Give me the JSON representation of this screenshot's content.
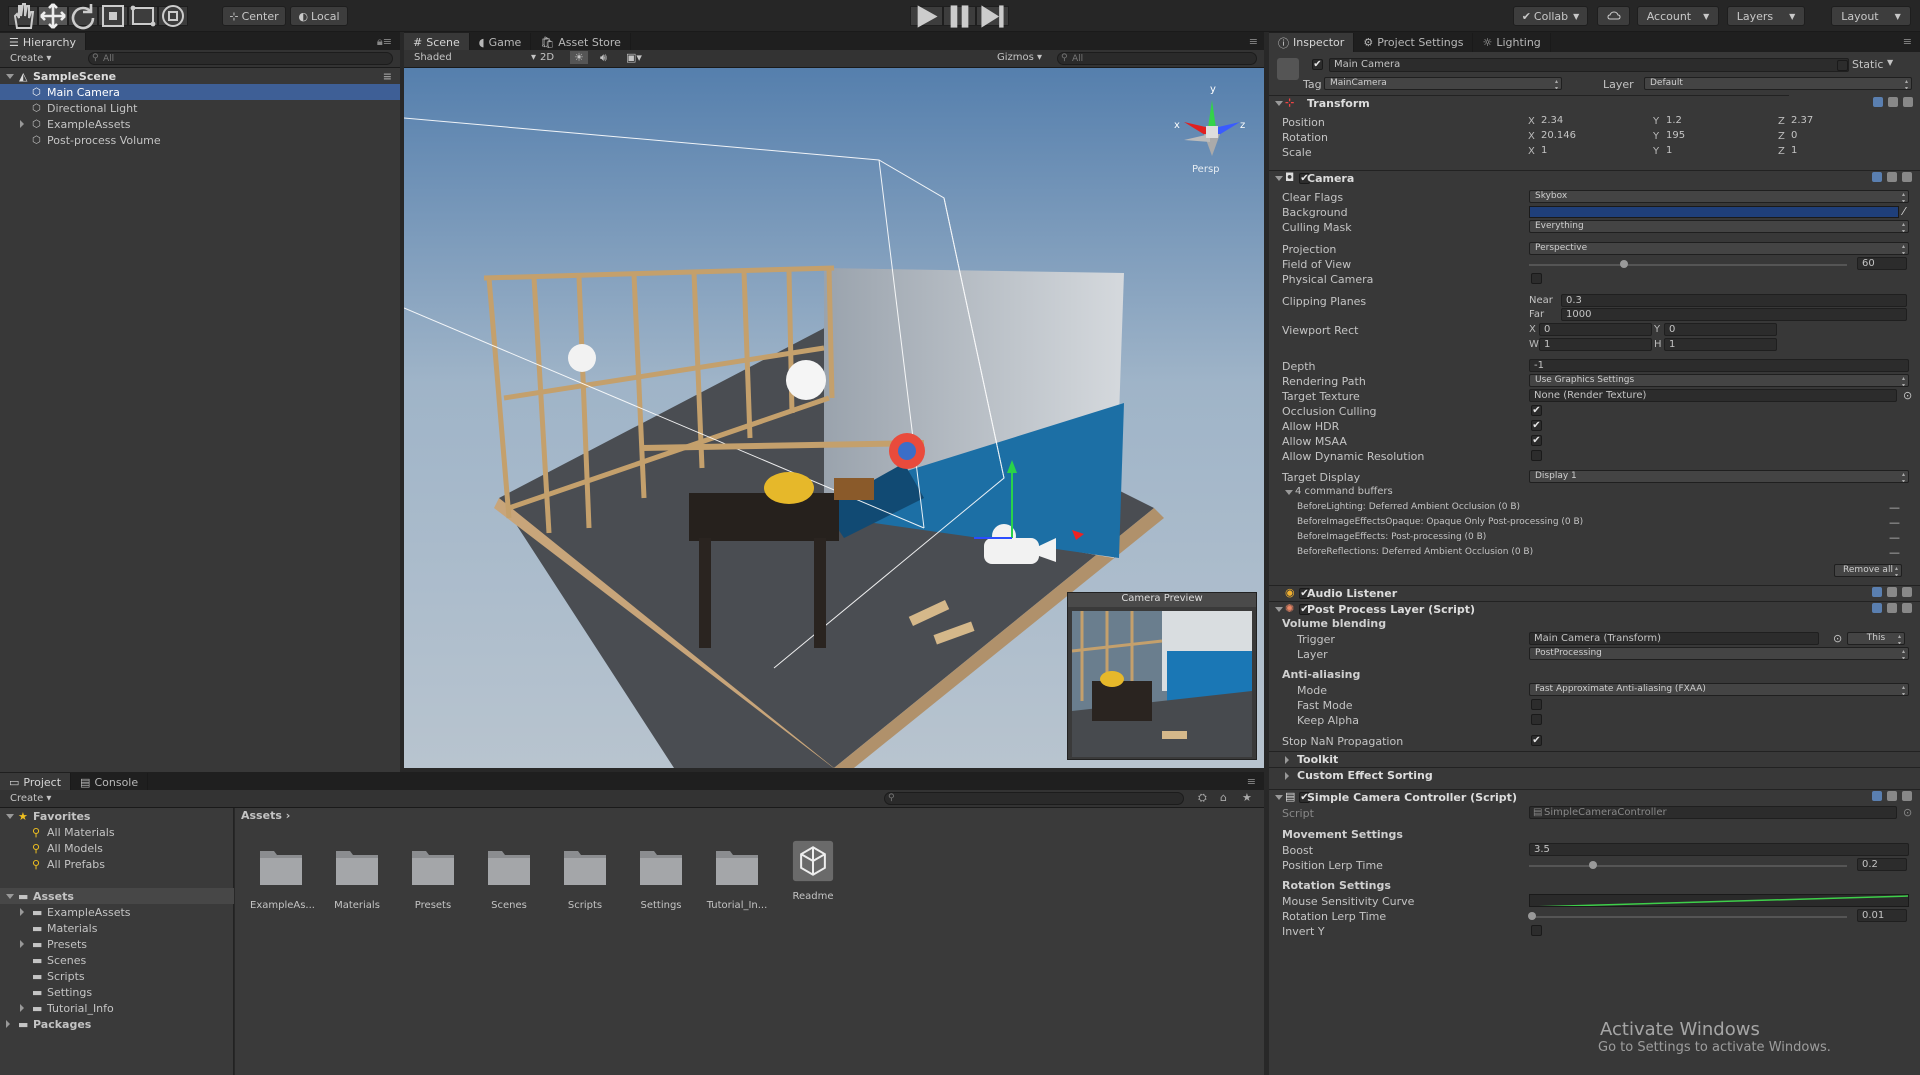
{
  "toolbar": {
    "pivot": "Center",
    "space": "Local",
    "collab": "Collab",
    "account": "Account",
    "layers": "Layers",
    "layout": "Layout",
    "tools": [
      "hand-tool",
      "move-tool",
      "rotate-tool",
      "scale-tool",
      "rect-tool",
      "transform-tool"
    ]
  },
  "hierarchy": {
    "tab": "Hierarchy",
    "create": "Create",
    "search": "All",
    "scene": "SampleScene",
    "items": [
      "Main Camera",
      "Directional Light",
      "ExampleAssets",
      "Post-process Volume"
    ]
  },
  "scene_view": {
    "tabs": [
      "Scene",
      "Game",
      "Asset Store"
    ],
    "shading": "Shaded",
    "mode_2d": "2D",
    "gizmos": "Gizmos",
    "search": "All",
    "persp": "Persp",
    "camera_preview": "Camera Preview",
    "axes": {
      "x": "x",
      "y": "y",
      "z": "z"
    }
  },
  "project": {
    "tabs": [
      "Project",
      "Console"
    ],
    "create": "Create",
    "favorites_label": "Favorites",
    "favorites": [
      "All Materials",
      "All Models",
      "All Prefabs"
    ],
    "assets_label": "Assets",
    "assets_tree": [
      "ExampleAssets",
      "Materials",
      "Presets",
      "Scenes",
      "Scripts",
      "Settings",
      "Tutorial_Info"
    ],
    "packages_label": "Packages",
    "breadcrumb": "Assets",
    "grid": [
      "ExampleAs...",
      "Materials",
      "Presets",
      "Scenes",
      "Scripts",
      "Settings",
      "Tutorial_In...",
      "Readme"
    ]
  },
  "inspector": {
    "tabs": [
      "Inspector",
      "Project Settings",
      "Lighting"
    ],
    "object_name": "Main Camera",
    "static_label": "Static",
    "tag_label": "Tag",
    "tag_value": "MainCamera",
    "layer_label": "Layer",
    "layer_value": "Default",
    "transform": {
      "title": "Transform",
      "position": {
        "label": "Position",
        "x": "2.34",
        "y": "1.2",
        "z": "2.37"
      },
      "rotation": {
        "label": "Rotation",
        "x": "20.146",
        "y": "195",
        "z": "0"
      },
      "scale": {
        "label": "Scale",
        "x": "1",
        "y": "1",
        "z": "1"
      }
    },
    "camera": {
      "title": "Camera",
      "clear_flags": {
        "label": "Clear Flags",
        "value": "Skybox"
      },
      "background": {
        "label": "Background",
        "color": "#1f3f7a"
      },
      "culling_mask": {
        "label": "Culling Mask",
        "value": "Everything"
      },
      "projection": {
        "label": "Projection",
        "value": "Perspective"
      },
      "fov": {
        "label": "Field of View",
        "value": "60",
        "fraction": 0.3
      },
      "physical_camera": {
        "label": "Physical Camera",
        "checked": false
      },
      "clipping": {
        "label": "Clipping Planes",
        "near_label": "Near",
        "near": "0.3",
        "far_label": "Far",
        "far": "1000"
      },
      "viewport": {
        "label": "Viewport Rect",
        "x": "0",
        "y": "0",
        "w": "1",
        "h": "1"
      },
      "depth": {
        "label": "Depth",
        "value": "-1"
      },
      "rendering_path": {
        "label": "Rendering Path",
        "value": "Use Graphics Settings"
      },
      "target_texture": {
        "label": "Target Texture",
        "value": "None (Render Texture)"
      },
      "occlusion_culling": {
        "label": "Occlusion Culling",
        "checked": true
      },
      "allow_hdr": {
        "label": "Allow HDR",
        "checked": true
      },
      "allow_msaa": {
        "label": "Allow MSAA",
        "checked": true
      },
      "allow_dynamic": {
        "label": "Allow Dynamic Resolution",
        "checked": false
      },
      "target_display": {
        "label": "Target Display",
        "value": "Display 1"
      },
      "command_buffers_label": "4 command buffers",
      "command_buffers": [
        "BeforeLighting: Deferred Ambient Occlusion (0 B)",
        "BeforeImageEffectsOpaque: Opaque Only Post-processing (0 B)",
        "BeforeImageEffects: Post-processing (0 B)",
        "BeforeReflections: Deferred Ambient Occlusion (0 B)"
      ],
      "remove_all": "Remove all"
    },
    "audio_listener": {
      "title": "Audio Listener"
    },
    "post_process": {
      "title": "Post Process Layer (Script)",
      "volume_blending": "Volume blending",
      "trigger": {
        "label": "Trigger",
        "value": "Main Camera (Transform)",
        "this": "This"
      },
      "layer": {
        "label": "Layer",
        "value": "PostProcessing"
      },
      "anti_aliasing": "Anti-aliasing",
      "mode": {
        "label": "Mode",
        "value": "Fast Approximate Anti-aliasing (FXAA)"
      },
      "fast_mode": {
        "label": "Fast Mode",
        "checked": false
      },
      "keep_alpha": {
        "label": "Keep Alpha",
        "checked": false
      },
      "stop_nan": {
        "label": "Stop NaN Propagation",
        "checked": true
      },
      "toolkit": "Toolkit",
      "custom_sorting": "Custom Effect Sorting"
    },
    "simple_camera": {
      "title": "Simple Camera Controller (Script)",
      "script": {
        "label": "Script",
        "value": "SimpleCameraController"
      },
      "movement_settings": "Movement Settings",
      "boost": {
        "label": "Boost",
        "value": "3.5"
      },
      "pos_lerp": {
        "label": "Position Lerp Time",
        "value": "0.2",
        "fraction": 0.2
      },
      "rotation_settings": "Rotation Settings",
      "mouse_curve": {
        "label": "Mouse Sensitivity Curve"
      },
      "rot_lerp": {
        "label": "Rotation Lerp Time",
        "value": "0.01",
        "fraction": 0.01
      },
      "invert_y": {
        "label": "Invert Y",
        "checked": false
      }
    }
  },
  "watermark": {
    "title": "Activate Windows",
    "subtitle": "Go to Settings to activate Windows."
  },
  "colors": {
    "selection": "#3e5f96",
    "accent_blue": "#5a7fb0",
    "panel": "#383838"
  }
}
